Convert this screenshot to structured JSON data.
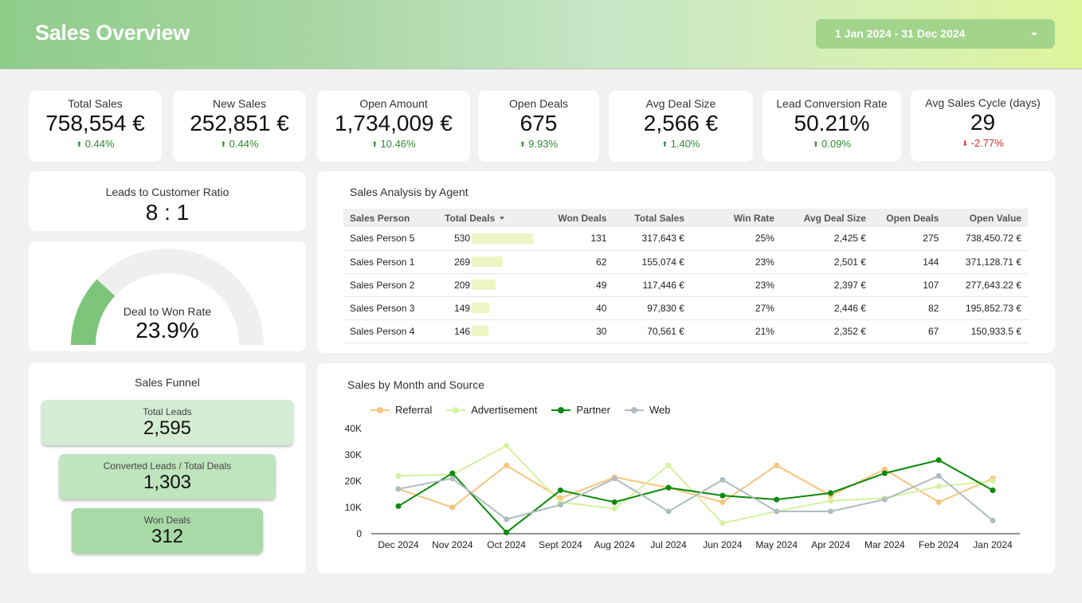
{
  "header": {
    "title": "Sales Overview",
    "date_range": "1 Jan 2024 - 31 Dec 2024"
  },
  "kpis": [
    {
      "label": "Total Sales",
      "value": "758,554 €",
      "delta": "0.44%",
      "direction": "up"
    },
    {
      "label": "New Sales",
      "value": "252,851 €",
      "delta": "0.44%",
      "direction": "up"
    },
    {
      "label": "Open Amount",
      "value": "1,734,009 €",
      "delta": "10.46%",
      "direction": "up"
    },
    {
      "label": "Open Deals",
      "value": "675",
      "delta": "9.93%",
      "direction": "up"
    },
    {
      "label": "Avg Deal Size",
      "value": "2,566 €",
      "delta": "1.40%",
      "direction": "up"
    },
    {
      "label": "Lead Conversion Rate",
      "value": "50.21%",
      "delta": "0.09%",
      "direction": "up"
    },
    {
      "label": "Avg Sales Cycle (days)",
      "value": "29",
      "delta": "-2.77%",
      "direction": "down"
    }
  ],
  "icons": {
    "up": "arrow-up-icon",
    "down": "arrow-down-icon",
    "up_glyph": "⬆",
    "down_glyph": "⬇"
  },
  "ratio": {
    "label": "Leads to Customer Ratio",
    "value": "8 : 1"
  },
  "gauge": {
    "label": "Deal to Won Rate",
    "value": "23.9%",
    "fraction": 0.239,
    "fill_color": "#7dc57a",
    "track_color": "#efefef"
  },
  "funnel": {
    "title": "Sales Funnel",
    "steps": [
      {
        "label": "Total Leads",
        "value": "2,595",
        "color": "#d3ecd3"
      },
      {
        "label": "Converted Leads / Total Deals",
        "value": "1,303",
        "color": "#bfe4be"
      },
      {
        "label": "Won Deals",
        "value": "312",
        "color": "#a8d9a6"
      }
    ]
  },
  "agents": {
    "title": "Sales Analysis by Agent",
    "columns": [
      "Sales Person",
      "Total Deals",
      "Won Deals",
      "Total Sales",
      "Win Rate",
      "Avg Deal Size",
      "Open Deals",
      "Open Value"
    ],
    "max_total_deals": 530,
    "rows": [
      {
        "name": "Sales Person 5",
        "total_deals": 530,
        "won": "131",
        "sales": "317,643 €",
        "win_rate": "25%",
        "avg": "2,425 €",
        "open": "275",
        "open_value": "738,450.72 €"
      },
      {
        "name": "Sales Person 1",
        "total_deals": 269,
        "won": "62",
        "sales": "155,074 €",
        "win_rate": "23%",
        "avg": "2,501 €",
        "open": "144",
        "open_value": "371,128.71 €"
      },
      {
        "name": "Sales Person 2",
        "total_deals": 209,
        "won": "49",
        "sales": "117,446 €",
        "win_rate": "23%",
        "avg": "2,397 €",
        "open": "107",
        "open_value": "277,643.22 €"
      },
      {
        "name": "Sales Person 3",
        "total_deals": 149,
        "won": "40",
        "sales": "97,830 €",
        "win_rate": "27%",
        "avg": "2,446 €",
        "open": "82",
        "open_value": "195,852.73 €"
      },
      {
        "name": "Sales Person 4",
        "total_deals": 146,
        "won": "30",
        "sales": "70,561 €",
        "win_rate": "21%",
        "avg": "2,352 €",
        "open": "67",
        "open_value": "150,933.5 €"
      }
    ]
  },
  "chart_data": {
    "type": "line",
    "title": "Sales by Month and Source",
    "categories": [
      "Dec 2024",
      "Nov 2024",
      "Oct 2024",
      "Sept 2024",
      "Aug 2024",
      "Jul 2024",
      "Jun 2024",
      "May 2024",
      "Apr 2024",
      "Mar 2024",
      "Feb 2024",
      "Jan 2024"
    ],
    "ylim": [
      0,
      40000
    ],
    "yticks": [
      0,
      10000,
      20000,
      30000,
      40000
    ],
    "ytick_labels": [
      "0",
      "10K",
      "20K",
      "30K",
      "40K"
    ],
    "legend_position": "top-left",
    "series": [
      {
        "name": "Referral",
        "color": "#f8c47c",
        "values": [
          17000,
          10000,
          26000,
          13500,
          21500,
          17500,
          12000,
          26000,
          14500,
          24500,
          12000,
          21000
        ]
      },
      {
        "name": "Advertisement",
        "color": "#d6f0a0",
        "values": [
          22000,
          22500,
          33500,
          12000,
          9500,
          26000,
          4000,
          8500,
          12500,
          13500,
          18000,
          20000
        ]
      },
      {
        "name": "Partner",
        "color": "#0a8a0a",
        "values": [
          10500,
          23000,
          500,
          16500,
          12000,
          17500,
          14500,
          13000,
          15500,
          23000,
          28000,
          16500
        ]
      },
      {
        "name": "Web",
        "color": "#b0bcc0",
        "values": [
          17000,
          21000,
          5500,
          11000,
          21000,
          8500,
          20500,
          8500,
          8500,
          13000,
          22000,
          5000
        ]
      }
    ]
  }
}
